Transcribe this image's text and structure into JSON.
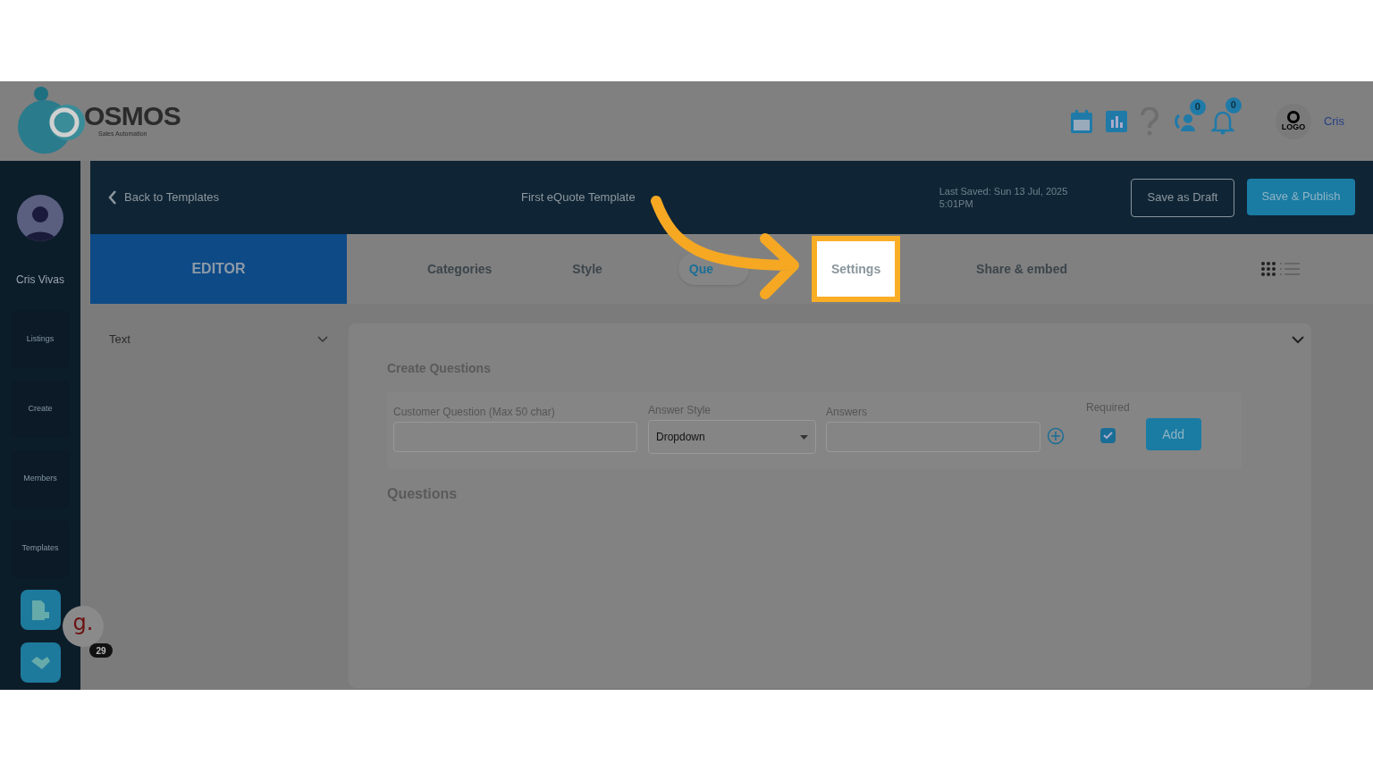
{
  "brand": {
    "name": "OSMOS",
    "tagline": "Sales Automation"
  },
  "header_icons": [
    {
      "kind": "calendar"
    },
    {
      "kind": "chart"
    },
    {
      "kind": "help"
    },
    {
      "kind": "users",
      "count": "0"
    },
    {
      "kind": "bell",
      "count": "0"
    }
  ],
  "account": {
    "logo_text": "LOGO",
    "name": "Cris"
  },
  "sidebar": {
    "user_name": "Cris Vivas",
    "items": [
      {
        "label": "Listings"
      },
      {
        "label": "Create"
      },
      {
        "label": "Members"
      },
      {
        "label": "Templates"
      }
    ]
  },
  "chat_widget": {
    "letter": "g.",
    "count": "29"
  },
  "topbar": {
    "back_label": "Back to Templates",
    "title": "First eQuote Template",
    "last_saved": "Last Saved: Sun 13 Jul, 2025 5:01PM",
    "buttons": [
      {
        "label": "Save as Draft",
        "kind": "outline"
      },
      {
        "label": "Save & Publish",
        "kind": "primary"
      }
    ]
  },
  "editor_tab": "EDITOR",
  "tabs": [
    {
      "label": "Categories",
      "selected": false,
      "highlighted": false
    },
    {
      "label": "Style",
      "selected": false,
      "highlighted": false
    },
    {
      "label": "Que",
      "selected": true,
      "highlighted": false
    },
    {
      "label": "Settings",
      "selected": false,
      "highlighted": true
    },
    {
      "label": "Share & embed",
      "selected": false,
      "highlighted": false
    }
  ],
  "left_panel": {
    "section": "Text",
    "expanded": true
  },
  "create_questions": {
    "title": "Create Questions",
    "question_label": "Customer Question (Max 50 char)",
    "style_label": "Answer Style",
    "style_value": "Dropdown",
    "answers_label": "Answers",
    "required_label": "Required",
    "required": true,
    "add_button": "Add"
  },
  "questions_title": "Questions"
}
